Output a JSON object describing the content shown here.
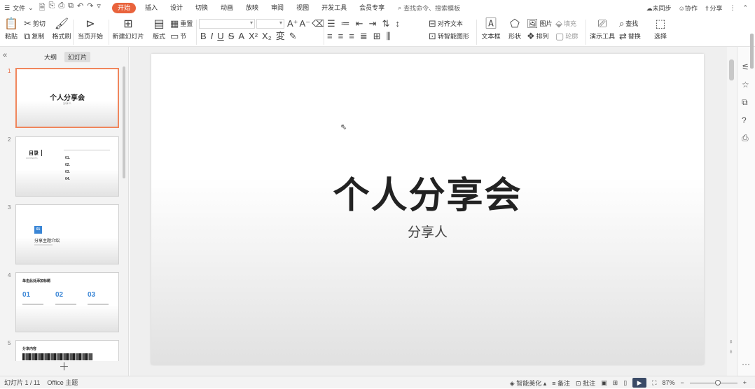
{
  "topbar": {
    "file_label": "文件",
    "tabs": [
      {
        "label": "开始",
        "active": true
      },
      {
        "label": "插入"
      },
      {
        "label": "设计"
      },
      {
        "label": "切换"
      },
      {
        "label": "动画"
      },
      {
        "label": "放映"
      },
      {
        "label": "审阅"
      },
      {
        "label": "视图"
      },
      {
        "label": "开发工具"
      },
      {
        "label": "会员专享"
      }
    ],
    "search_placeholder": "查找命令、搜索模板",
    "sync_label": "未同步",
    "collab_label": "协作",
    "share_label": "分享"
  },
  "ribbon": {
    "paste": "粘贴",
    "cut": "剪切",
    "copy": "复制",
    "format_painter": "格式刷",
    "from_current": "当页开始",
    "new_slide": "新建幻灯片",
    "layout": "版式",
    "section": "节",
    "reset": "重置",
    "convert_smartart": "转智能图形",
    "align_text": "对齐文本",
    "textbox": "文本框",
    "shape": "形状",
    "picture": "图片",
    "arrange": "排列",
    "fill": "填充",
    "outline": "轮廓",
    "presenter_tools": "演示工具",
    "find": "查找",
    "replace": "替换",
    "select": "选择"
  },
  "panel": {
    "tab_outline": "大纲",
    "tab_slides": "幻灯片",
    "thumbs": [
      {
        "num": "1",
        "title": "个人分享会",
        "sub": "分享人"
      },
      {
        "num": "2",
        "title": "目录",
        "sub": "CONTENTS",
        "items": [
          "01.",
          "02.",
          "03.",
          "04."
        ]
      },
      {
        "num": "3",
        "badge": "01",
        "title": "分享主题介绍"
      },
      {
        "num": "4",
        "title": "单击此处添加标题",
        "cols": [
          "01",
          "02",
          "03"
        ]
      },
      {
        "num": "5",
        "title": "分享内容"
      }
    ]
  },
  "slide": {
    "title": "个人分享会",
    "subtitle": "分享人"
  },
  "status": {
    "slide_info": "幻灯片 1 / 11",
    "theme": "Office 主题",
    "beautify": "智能美化",
    "notes": "备注",
    "comment": "批注",
    "zoom": "87%"
  }
}
